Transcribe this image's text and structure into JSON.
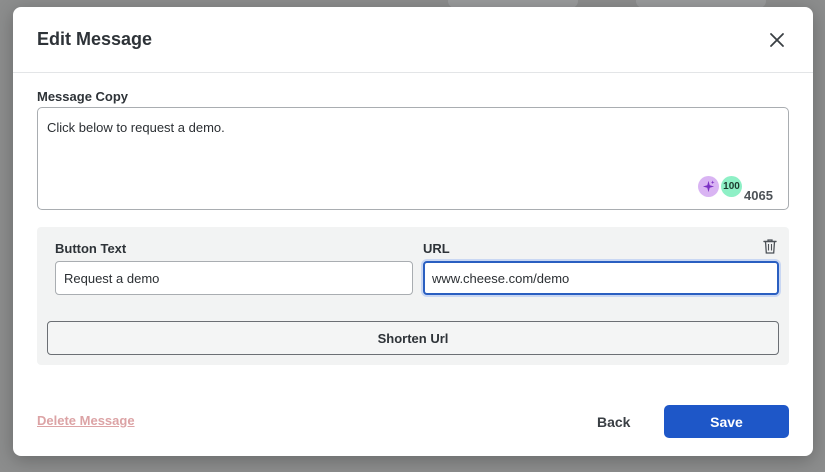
{
  "dialog": {
    "title": "Edit Message"
  },
  "message_copy": {
    "label": "Message Copy",
    "value": "Click below to request a demo.",
    "ai_icon": "sparkle-icon",
    "count_badge": "100",
    "char_count": "4065"
  },
  "button_row": {
    "button_text_label": "Button Text",
    "url_label": "URL",
    "button_text_value": "Request a demo",
    "url_value": "www.cheese.com/demo",
    "delete_icon": "trash-icon"
  },
  "shorten_url_label": "Shorten Url",
  "footer": {
    "delete_label": "Delete Message",
    "back_label": "Back",
    "save_label": "Save"
  },
  "colors": {
    "primary": "#1e57c8",
    "delete_link": "#dca3a5",
    "ai_badge": "#d9b4f3",
    "count_badge": "#8ef0c6"
  }
}
